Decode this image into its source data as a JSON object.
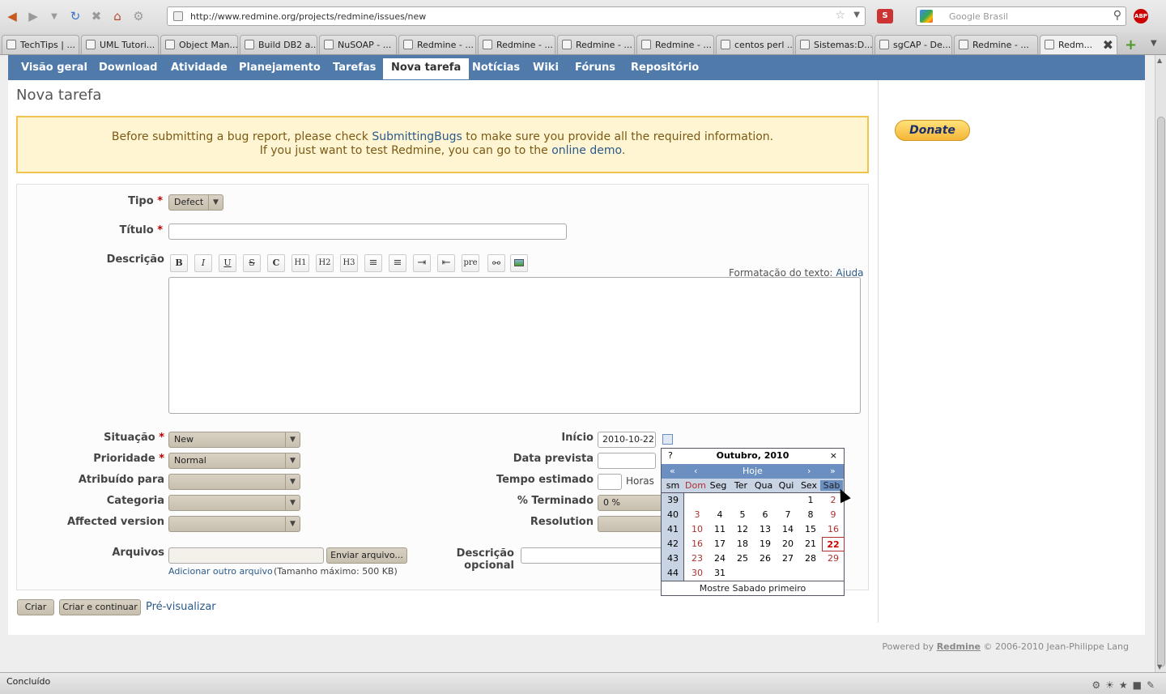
{
  "browser": {
    "url": "http://www.redmine.org/projects/redmine/issues/new",
    "search_placeholder": "Google Brasil",
    "addon_label": "S",
    "abp_label": "ABP",
    "tabs": [
      {
        "label": "TechTips | ..."
      },
      {
        "label": "UML Tutori..."
      },
      {
        "label": "Object Man..."
      },
      {
        "label": "Build DB2 a..."
      },
      {
        "label": "NuSOAP - ..."
      },
      {
        "label": "Redmine - ..."
      },
      {
        "label": "Redmine - ..."
      },
      {
        "label": "Redmine - ..."
      },
      {
        "label": "Redmine - ..."
      },
      {
        "label": "centos perl ..."
      },
      {
        "label": "Sistemas:D..."
      },
      {
        "label": "sgCAP - De..."
      },
      {
        "label": "Redmine - ..."
      },
      {
        "label": "Redm..."
      }
    ],
    "status": "Concluído"
  },
  "menu": {
    "items": [
      "Visão geral",
      "Download",
      "Atividade",
      "Planejamento",
      "Tarefas",
      "Nova tarefa",
      "Notícias",
      "Wiki",
      "Fóruns",
      "Repositório"
    ],
    "selected": "Nova tarefa"
  },
  "page": {
    "title": "Nova tarefa",
    "flash_line1_pre": "Before submitting a bug report, please check ",
    "flash_line1_link": "SubmittingBugs",
    "flash_line1_post": " to make sure you provide all the required information.",
    "flash_line2_pre": "If you just want to test Redmine, you can go to the ",
    "flash_line2_link": "online demo",
    "flash_line2_post": "."
  },
  "form": {
    "tipo_label": "Tipo",
    "tipo_value": "Defect",
    "titulo_label": "Título",
    "titulo_value": "",
    "descricao_label": "Descrição",
    "toolbar": [
      "B",
      "I",
      "U",
      "S",
      "C",
      "H1",
      "H2",
      "H3",
      "ul",
      "ol",
      "indent",
      "outdent",
      "pre",
      "link",
      "img"
    ],
    "formatacao_label": "Formatação do texto: ",
    "formatacao_link": "Ajuda",
    "situacao_label": "Situação",
    "situacao_value": "New",
    "prioridade_label": "Prioridade",
    "prioridade_value": "Normal",
    "atribuido_label": "Atribuído para",
    "atribuido_value": "",
    "categoria_label": "Categoria",
    "categoria_value": "",
    "affected_label": "Affected version",
    "affected_value": "",
    "inicio_label": "Início",
    "inicio_value": "2010-10-22",
    "data_prevista_label": "Data prevista",
    "data_prevista_value": "",
    "tempo_label": "Tempo estimado",
    "tempo_value": "",
    "horas_label": "Horas",
    "terminado_label": "% Terminado",
    "terminado_value": "0 %",
    "resolution_label": "Resolution",
    "resolution_value": "",
    "arquivos_label": "Arquivos",
    "enviar_button": "Enviar arquivo...",
    "descricao_opcional_label": "Descrição opcional",
    "adicionar_link": "Adicionar outro arquivo",
    "tamanho_text": "(Tamanho máximo: 500 KB)"
  },
  "actions": {
    "criar": "Criar",
    "criar_continuar": "Criar e continuar",
    "preview": "Pré-visualizar"
  },
  "sidebar": {
    "donate": "Donate"
  },
  "footer": {
    "powered_pre": "Powered by ",
    "powered_link": "Redmine",
    "powered_post": " © 2006-2010 Jean-Philippe Lang"
  },
  "calendar": {
    "help": "?",
    "close": "×",
    "title": "Outubro, 2010",
    "nav": {
      "prev_year": "«",
      "prev_month": "‹",
      "today": "Hoje",
      "next_month": "›",
      "next_year": "»"
    },
    "days": [
      "sm",
      "Dom",
      "Seg",
      "Ter",
      "Qua",
      "Qui",
      "Sex",
      "Sab"
    ],
    "weeks": [
      {
        "wk": "39",
        "days": [
          "",
          "",
          "",
          "",
          "",
          "1",
          "2"
        ]
      },
      {
        "wk": "40",
        "days": [
          "3",
          "4",
          "5",
          "6",
          "7",
          "8",
          "9"
        ]
      },
      {
        "wk": "41",
        "days": [
          "10",
          "11",
          "12",
          "13",
          "14",
          "15",
          "16"
        ]
      },
      {
        "wk": "42",
        "days": [
          "16",
          "17",
          "18",
          "19",
          "20",
          "21",
          "22"
        ]
      },
      {
        "wk": "43",
        "days": [
          "23",
          "24",
          "25",
          "26",
          "27",
          "28",
          "29"
        ]
      },
      {
        "wk": "44",
        "days": [
          "30",
          "31",
          "",
          "",
          "",
          "",
          ""
        ]
      }
    ],
    "today": "22",
    "footer": "Mostre Sabado primeiro"
  }
}
